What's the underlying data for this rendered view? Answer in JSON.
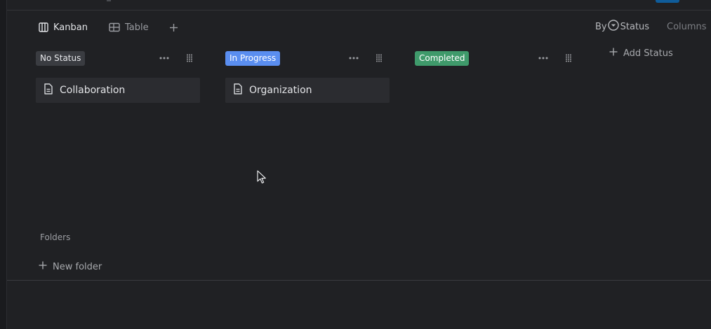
{
  "views": {
    "kanban_label": "Kanban",
    "table_label": "Table"
  },
  "toolbar": {
    "by_label": "By",
    "group_field": "Status",
    "columns_label": "Columns"
  },
  "board": {
    "columns": [
      {
        "status": "No Status",
        "color": "#3a3c41",
        "cards": [
          "Collaboration"
        ]
      },
      {
        "status": "In Progress",
        "color": "#5a8ef0",
        "cards": [
          "Organization"
        ]
      },
      {
        "status": "Completed",
        "color": "#3f9a6b",
        "cards": []
      }
    ],
    "add_status_label": "Add Status"
  },
  "sidebar": {
    "folders_label": "Folders",
    "new_folder_label": "New folder"
  }
}
